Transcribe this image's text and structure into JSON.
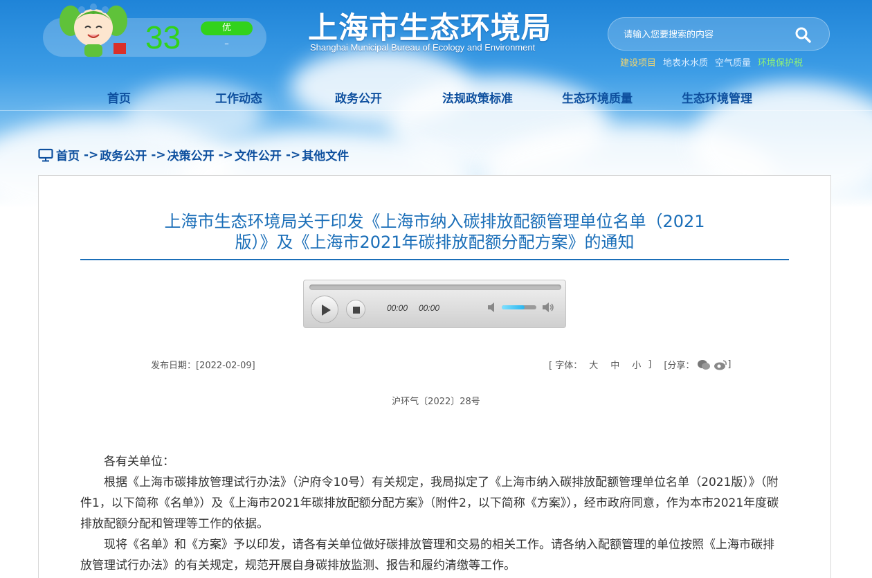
{
  "header": {
    "aqi_value": "33",
    "aqi_level": "优",
    "aqi_pollutant": "–",
    "logo_cn": "上海市生态环境局",
    "logo_en": "Shanghai Municipal Bureau of Ecology and Environment",
    "search_placeholder": "请输入您要搜索的内容",
    "quick_links": [
      {
        "label": "建设项目",
        "color": "#f5d76e"
      },
      {
        "label": "地表水水质",
        "color": "#d8ecff"
      },
      {
        "label": "空气质量",
        "color": "#d8ecff"
      },
      {
        "label": "环境保护税",
        "color": "#8ef07a"
      }
    ]
  },
  "nav": {
    "items": [
      "首页",
      "工作动态",
      "政务公开",
      "法规政策标准",
      "生态环境质量",
      "生态环境管理"
    ]
  },
  "breadcrumb": {
    "items": [
      "首页",
      "政务公开",
      "决策公开",
      "文件公开",
      "其他文件"
    ],
    "separator": "->"
  },
  "article": {
    "title_line1": "上海市生态环境局关于印发《上海市纳入碳排放配额管理单位名单（2021",
    "title_line2": "版）》及《上海市2021年碳排放配额分配方案》的通知",
    "player": {
      "current_time": "00:00",
      "duration": "00:00",
      "volume": 0.65
    },
    "publish_date_label": "发布日期：",
    "publish_date": "[2022-02-09]",
    "font_label": "[ 字体：",
    "font_sizes": [
      "大",
      "中",
      "小"
    ],
    "font_close": "]",
    "share_label": "[分享：",
    "share_close": "]",
    "doc_number": "沪环气〔2022〕28号",
    "paragraphs": [
      "各有关单位：",
      "根据《上海市碳排放管理试行办法》（沪府令10号）有关规定，我局拟定了《上海市纳入碳排放配额管理单位名单（2021版）》（附件1，以下简称《名单》）及《上海市2021年碳排放配额分配方案》（附件2，以下简称《方案》），经市政府同意，作为本市2021年度碳排放配额分配和管理等工作的依据。",
      "现将《名单》和《方案》予以印发，请各有关单位做好碳排放管理和交易的相关工作。请各纳入配额管理的单位按照《上海市碳排放管理试行办法》的有关规定，规范开展自身碳排放监测、报告和履约清缴等工作。"
    ]
  },
  "colors": {
    "nav_text": "#0d4f9e",
    "title_blue": "#1a6eb8",
    "aqi_green": "#32d21b"
  }
}
